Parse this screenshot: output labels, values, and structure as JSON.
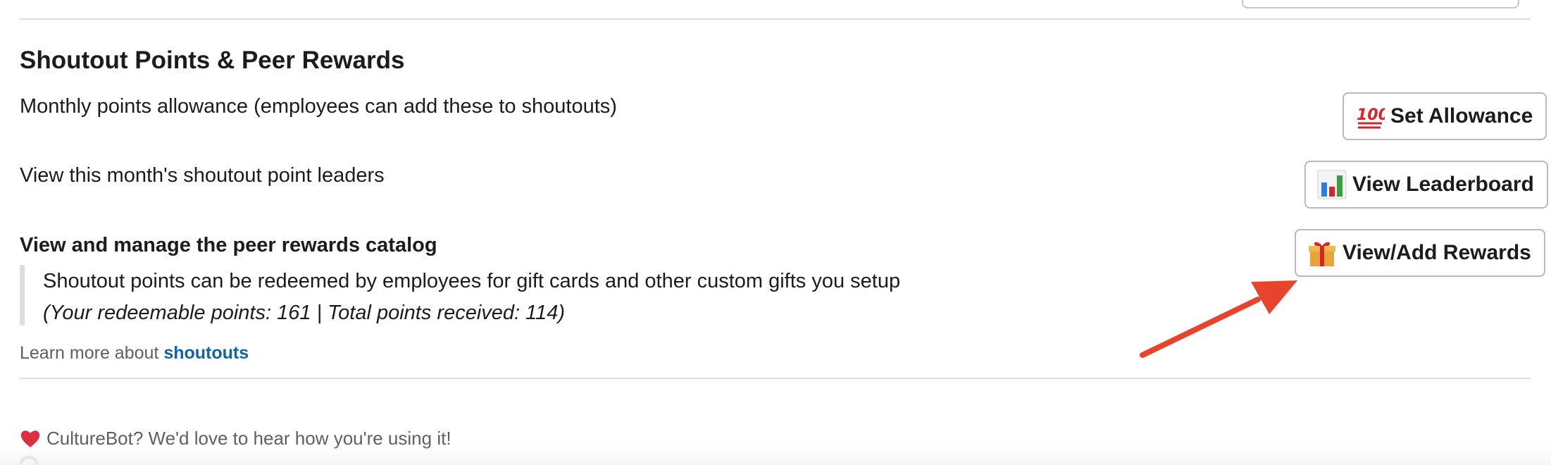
{
  "section": {
    "title": "Shoutout Points & Peer Rewards"
  },
  "rows": {
    "allowance_text": "Monthly points allowance (employees can add these to shoutouts)",
    "leaders_text": "View this month's shoutout point leaders",
    "catalog_text": "View and manage the peer rewards catalog"
  },
  "buttons": {
    "set_allowance": {
      "icon": "hundred-points-emoji",
      "label": "Set Allowance"
    },
    "view_leaderboard": {
      "icon": "bar-chart-emoji",
      "label": "View Leaderboard"
    },
    "view_add_rewards": {
      "icon": "gift-emoji",
      "label": "View/Add Rewards"
    }
  },
  "quote": {
    "line1": "Shoutout points can be redeemed by employees for gift cards and other custom gifts you setup",
    "line2": "(Your redeemable points: 161 | Total points received: 114)"
  },
  "learn_more": {
    "prefix": "Learn more about",
    "link": "shoutouts"
  },
  "footer": {
    "feedback": "CultureBot? We'd love to hear how you're using it!",
    "heart_icon": "heart-emoji"
  },
  "colors": {
    "link": "#1264a3",
    "arrow": "#e8432c",
    "divider": "#dddddd",
    "muted_text": "#616061"
  }
}
